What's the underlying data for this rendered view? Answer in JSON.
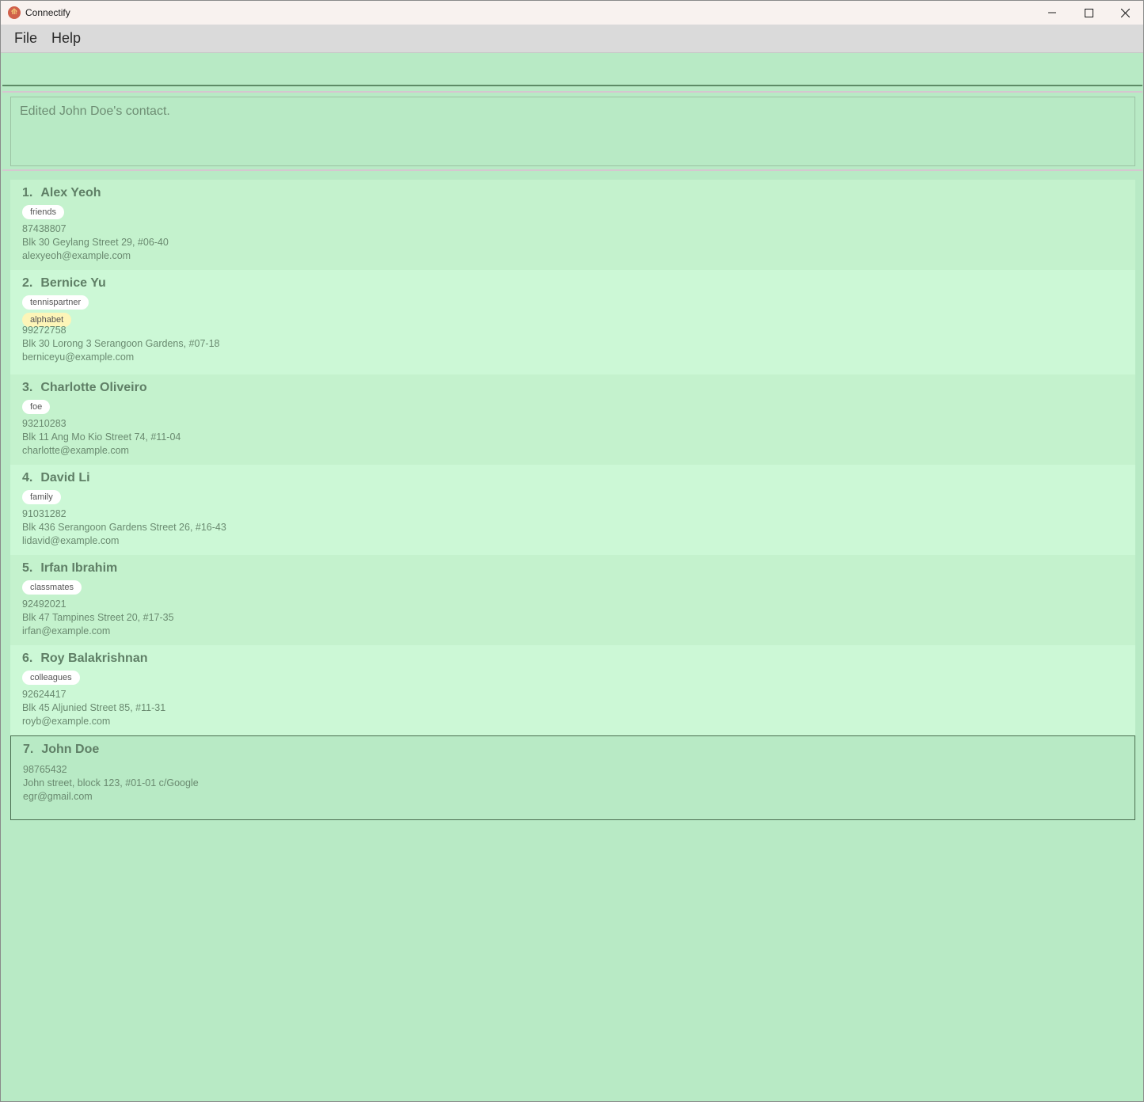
{
  "window": {
    "title": "Connectify",
    "icon": "connectify-app-icon",
    "controls": [
      "minimize-icon",
      "maximize-icon",
      "close-icon"
    ]
  },
  "menu": {
    "file": "File",
    "help": "Help"
  },
  "command": {
    "value": ""
  },
  "result": {
    "message": "Edited John Doe's contact."
  },
  "persons": [
    {
      "index": "1.",
      "name": "Alex Yeoh",
      "tags": [
        {
          "label": "friends",
          "color": "#ffffff"
        }
      ],
      "phone": "87438807",
      "address": "Blk 30 Geylang Street 29, #06-40",
      "email": "alexyeoh@example.com"
    },
    {
      "index": "2.",
      "name": "Bernice Yu",
      "tags": [
        {
          "label": "tennispartner",
          "color": "#ffffff"
        },
        {
          "label": "alphabet",
          "color": "#fdf5b8"
        }
      ],
      "phone": "99272758",
      "address": "Blk 30 Lorong 3 Serangoon Gardens, #07-18",
      "email": "berniceyu@example.com"
    },
    {
      "index": "3.",
      "name": "Charlotte Oliveiro",
      "tags": [
        {
          "label": "foe",
          "color": "#ffffff"
        }
      ],
      "phone": "93210283",
      "address": "Blk 11 Ang Mo Kio Street 74, #11-04",
      "email": "charlotte@example.com"
    },
    {
      "index": "4.",
      "name": "David Li",
      "tags": [
        {
          "label": "family",
          "color": "#ffffff"
        }
      ],
      "phone": "91031282",
      "address": "Blk 436 Serangoon Gardens Street 26, #16-43",
      "email": "lidavid@example.com"
    },
    {
      "index": "5.",
      "name": "Irfan Ibrahim",
      "tags": [
        {
          "label": "classmates",
          "color": "#ffffff"
        }
      ],
      "phone": "92492021",
      "address": "Blk 47 Tampines Street 20, #17-35",
      "email": "irfan@example.com"
    },
    {
      "index": "6.",
      "name": "Roy Balakrishnan",
      "tags": [
        {
          "label": "colleagues",
          "color": "#ffffff"
        }
      ],
      "phone": "92624417",
      "address": "Blk 45 Aljunied Street 85, #11-31",
      "email": "royb@example.com"
    },
    {
      "index": "7.",
      "name": "John Doe",
      "tags": [],
      "phone": "98765432",
      "address": "John street, block 123, #01-01 c/Google",
      "email": "egr@gmail.com",
      "selected": true
    }
  ]
}
